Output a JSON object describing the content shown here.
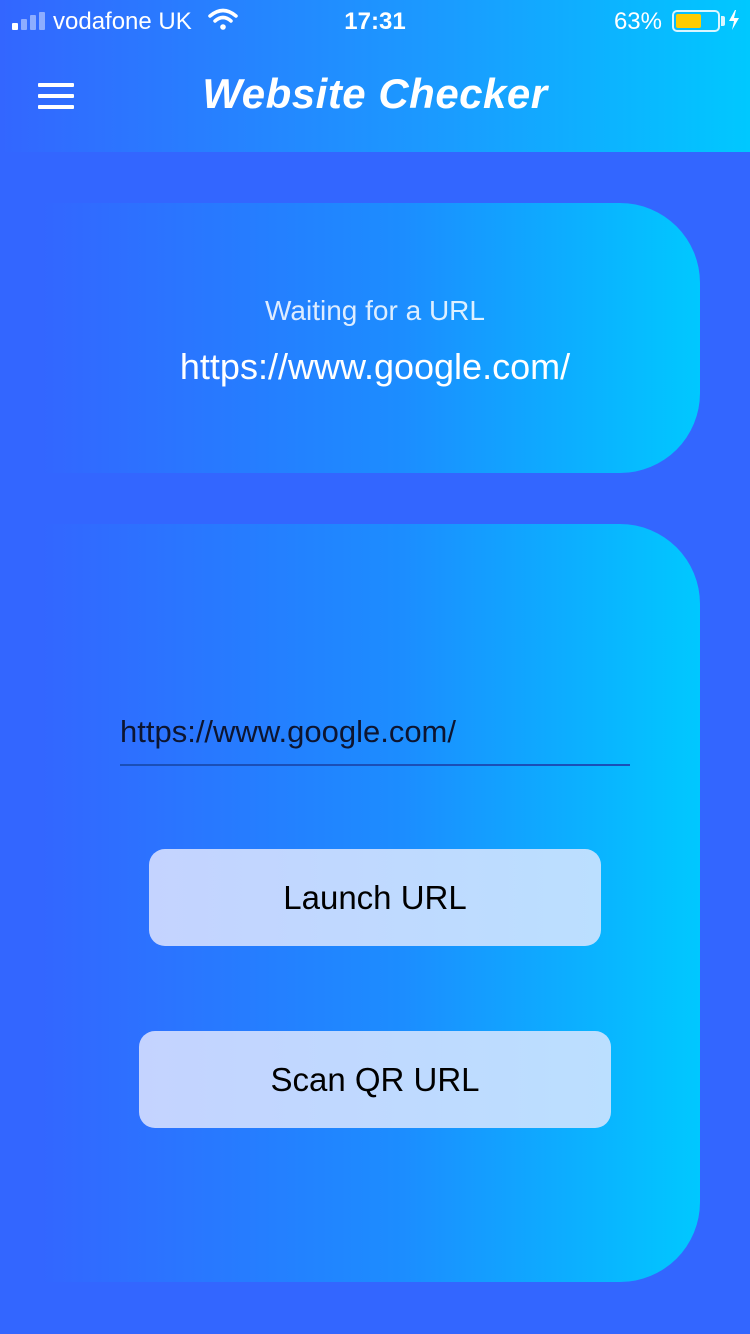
{
  "status_bar": {
    "carrier": "vodafone UK",
    "time": "17:31",
    "battery_percent": "63%",
    "battery_level": 0.63,
    "battery_color": "#ffcc00"
  },
  "header": {
    "title": "Website Checker",
    "menu_icon": "hamburger-menu-icon"
  },
  "status_card": {
    "label": "Waiting for a URL",
    "url": "https://www.google.com/"
  },
  "form": {
    "url_value": "https://www.google.com/",
    "launch_label": "Launch URL",
    "scan_label": "Scan QR URL"
  },
  "colors": {
    "background": "#3366ff",
    "accent": "#00c8ff",
    "button": "#c4d3ff"
  }
}
